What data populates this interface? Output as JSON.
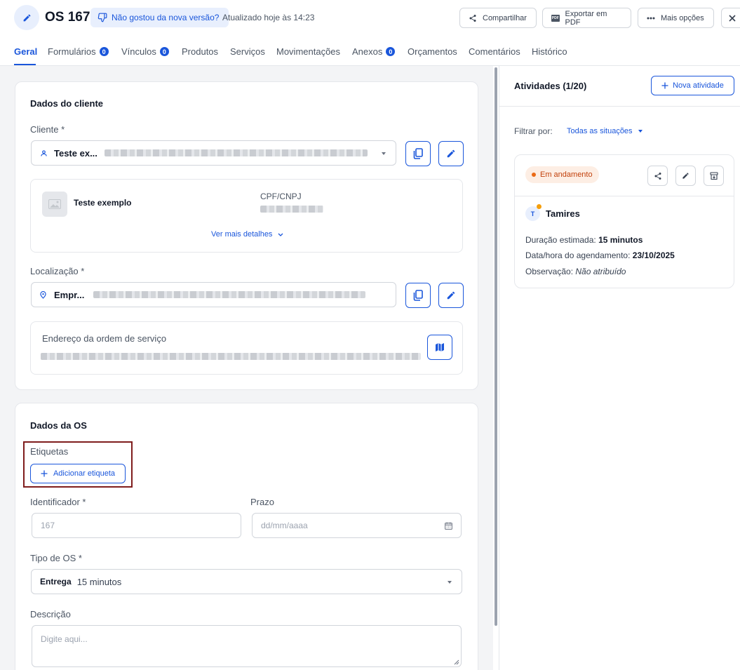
{
  "header": {
    "title": "OS 167",
    "feedback_label": "Não gostou da nova versão?",
    "updated_text": "Atualizado hoje às 14:23",
    "share_label": "Compartilhar",
    "export_pdf_label": "Exportar em PDF",
    "pdf_badge": "PDF",
    "more_options_label": "Mais opções"
  },
  "tabs": [
    {
      "label": "Geral"
    },
    {
      "label": "Formulários",
      "count": "0"
    },
    {
      "label": "Vínculos",
      "count": "0"
    },
    {
      "label": "Produtos"
    },
    {
      "label": "Serviços"
    },
    {
      "label": "Movimentações"
    },
    {
      "label": "Anexos",
      "count": "0"
    },
    {
      "label": "Orçamentos"
    },
    {
      "label": "Comentários"
    },
    {
      "label": "Histórico"
    }
  ],
  "client_section": {
    "title": "Dados do cliente",
    "client_label": "Cliente *",
    "client_value": "Teste ex...",
    "client_name": "Teste exemplo",
    "cpf_label": "CPF/CNPJ",
    "more_details": "Ver mais detalhes",
    "location_label": "Localização *",
    "location_value": "Empr...",
    "address_label": "Endereço da ordem de serviço"
  },
  "os_section": {
    "title": "Dados da OS",
    "tags_label": "Etiquetas",
    "add_tag_label": "Adicionar etiqueta",
    "identifier_label": "Identificador *",
    "identifier_value": "167",
    "deadline_label": "Prazo",
    "deadline_placeholder": "dd/mm/aaaa",
    "type_label": "Tipo de OS *",
    "type_value": "Entrega",
    "type_duration": "15 minutos",
    "description_label": "Descrição",
    "description_placeholder": "Digite aqui..."
  },
  "activities": {
    "title": "Atividades (1/20)",
    "new_activity_label": "Nova atividade",
    "filter_label": "Filtrar por:",
    "filter_value": "Todas as situações",
    "card": {
      "status": "Em andamento",
      "user_initial": "T",
      "user_name": "Tamires",
      "duration_label": "Duração estimada:",
      "duration_value": "15 minutos",
      "schedule_label": "Data/hora do agendamento:",
      "schedule_value": "23/10/2025",
      "observation_label": "Observação:",
      "observation_value": "Não atribuído"
    }
  },
  "colors": {
    "accent": "#1a56db",
    "highlight_box": "#7f1d1d",
    "status_in_progress": "#ea6a16"
  }
}
